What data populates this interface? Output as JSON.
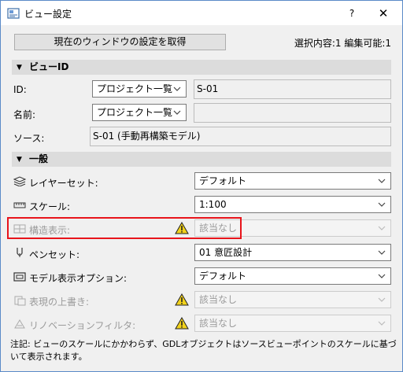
{
  "window": {
    "title": "ビュー設定",
    "help_label": "?",
    "close_label": "✕"
  },
  "toolbar": {
    "get_settings_label": "現在のウィンドウの設定を取得",
    "selection_info": "選択内容:1 編集可能:1"
  },
  "view_id_section": {
    "title": "ビューID",
    "id_label": "ID:",
    "id_source": "プロジェクト一覧",
    "id_value": "S-01",
    "name_label": "名前:",
    "name_source": "プロジェクト一覧",
    "name_value": "",
    "source_label": "ソース:",
    "source_value": "S-01 (手動再構築モデル)"
  },
  "general_section": {
    "title": "一般",
    "rows": [
      {
        "label": "レイヤーセット:",
        "value": "デフォルト",
        "icon": "layer-set-icon",
        "disabled": false,
        "warning": false
      },
      {
        "label": "スケール:",
        "value": "1:100",
        "icon": "scale-icon",
        "disabled": false,
        "warning": false
      },
      {
        "label": "構造表示:",
        "value": "該当なし",
        "icon": "structure-display-icon",
        "disabled": true,
        "warning": true
      },
      {
        "label": "ペンセット:",
        "value": "01 意匠設計",
        "icon": "pen-set-icon",
        "disabled": false,
        "warning": false
      },
      {
        "label": "モデル表示オプション:",
        "value": "デフォルト",
        "icon": "model-display-icon",
        "disabled": false,
        "warning": false
      },
      {
        "label": "表現の上書き:",
        "value": "該当なし",
        "icon": "graphic-override-icon",
        "disabled": true,
        "warning": true
      },
      {
        "label": "リノベーションフィルタ:",
        "value": "該当なし",
        "icon": "renovation-filter-icon",
        "disabled": true,
        "warning": true
      }
    ]
  },
  "note": "注記: ビューのスケールにかかわらず、GDLオブジェクトはソースビューポイントのスケールに基づいて表示されます。",
  "colors": {
    "highlight": "#e8141b",
    "warning_fill": "#f2d21b",
    "section_bg": "#dcdcdc"
  }
}
